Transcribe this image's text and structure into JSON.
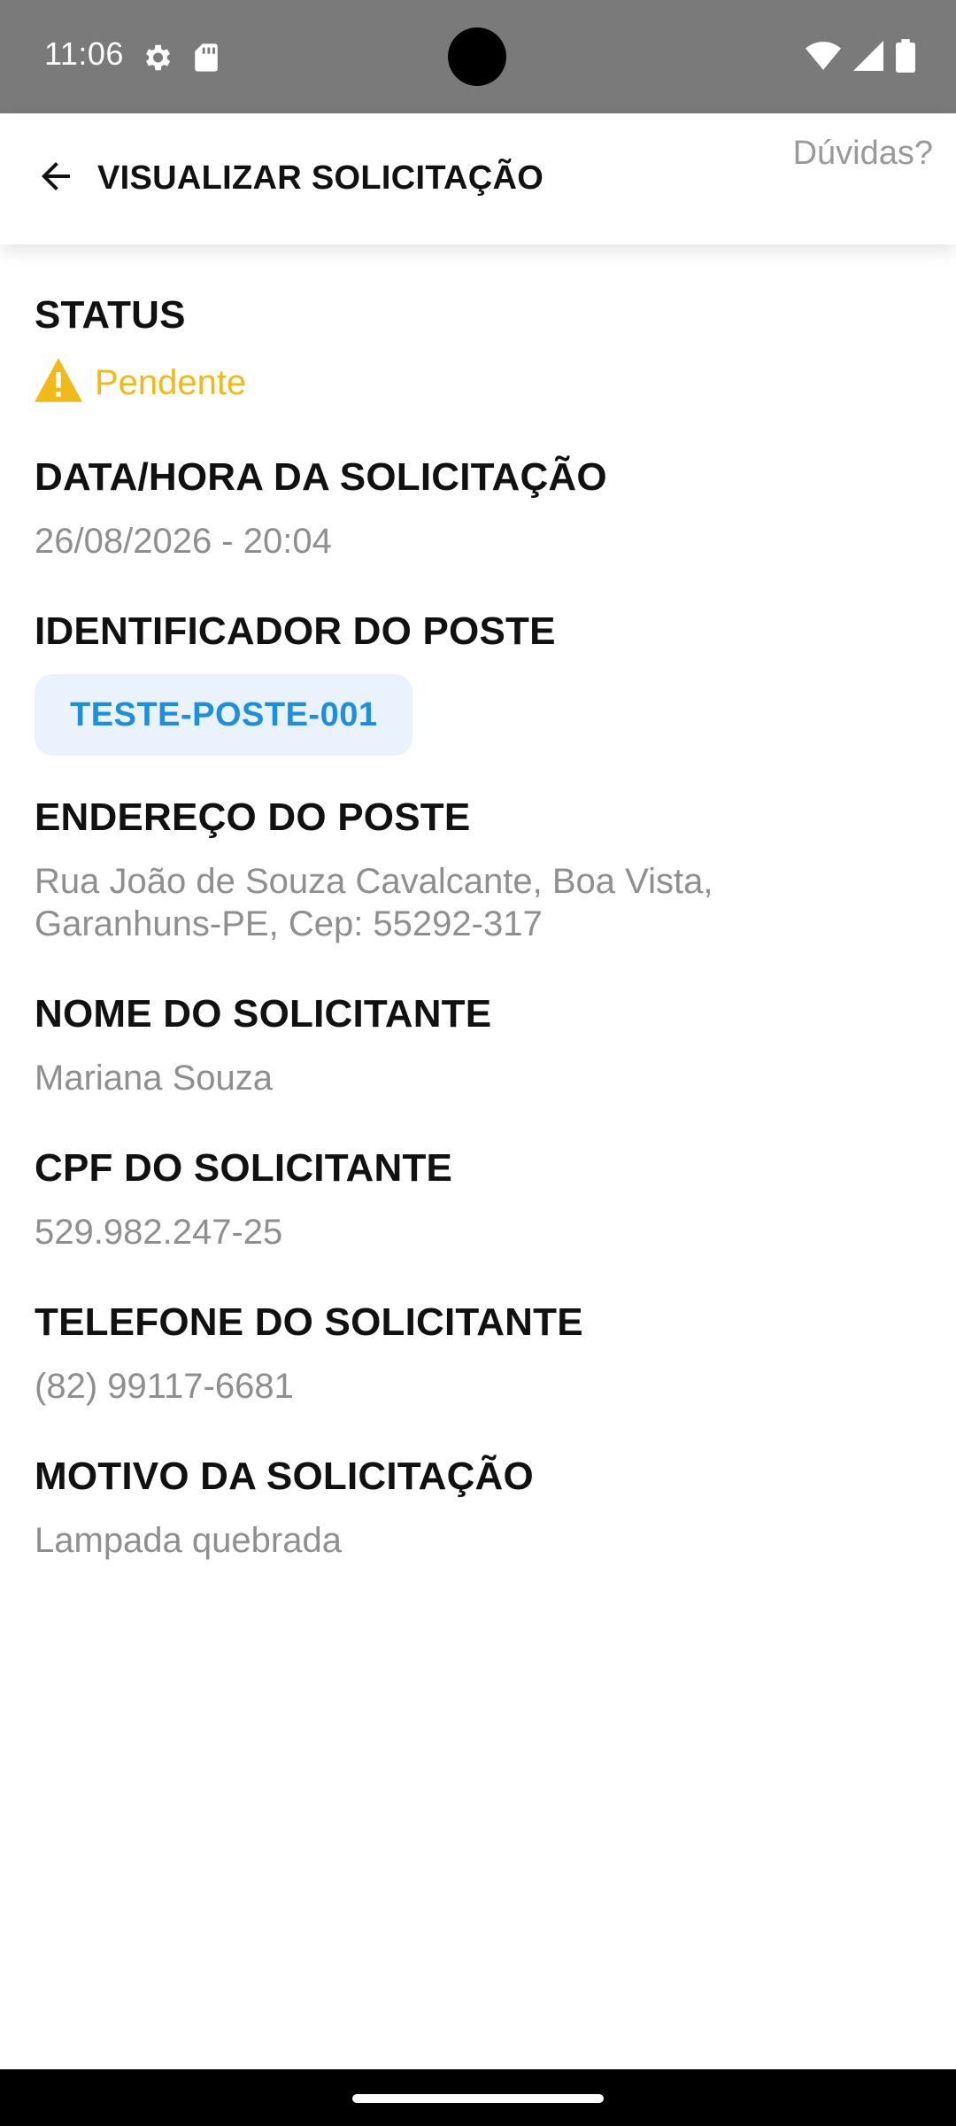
{
  "status_bar": {
    "time": "11:06"
  },
  "app_bar": {
    "title": "VISUALIZAR SOLICITAÇÃO",
    "help": "Dúvidas?"
  },
  "fields": {
    "status": {
      "label": "STATUS",
      "value": "Pendente",
      "color": "#f2b91a"
    },
    "datetime": {
      "label": "DATA/HORA DA SOLICITAÇÃO",
      "value": "26/08/2026 - 20:04"
    },
    "post_id": {
      "label": "IDENTIFICADOR DO POSTE",
      "value": "TESTE-POSTE-001"
    },
    "address": {
      "label": "ENDEREÇO DO POSTE",
      "line1": "Rua João de Souza Cavalcante, Boa Vista,",
      "line2": "Garanhuns-PE, Cep: 55292-317"
    },
    "name": {
      "label": "NOME DO SOLICITANTE",
      "value": "Mariana Souza"
    },
    "cpf": {
      "label": "CPF DO SOLICITANTE",
      "value": "529.982.247-25"
    },
    "phone": {
      "label": "TELEFONE DO SOLICITANTE",
      "value": "(82) 99117-6681"
    },
    "reason": {
      "label": "MOTIVO DA SOLICITAÇÃO",
      "value": "Lampada quebrada"
    }
  },
  "icons": {
    "back": "arrow-back-icon",
    "status": "warning-icon",
    "settings": "gear-icon",
    "sd": "sd-card-icon",
    "wifi": "wifi-icon",
    "signal": "signal-icon",
    "battery": "battery-icon"
  },
  "colors": {
    "accent": "#1e8fe0",
    "chip_bg": "#eaf3fd",
    "status_bar": "#7a7a7a"
  }
}
